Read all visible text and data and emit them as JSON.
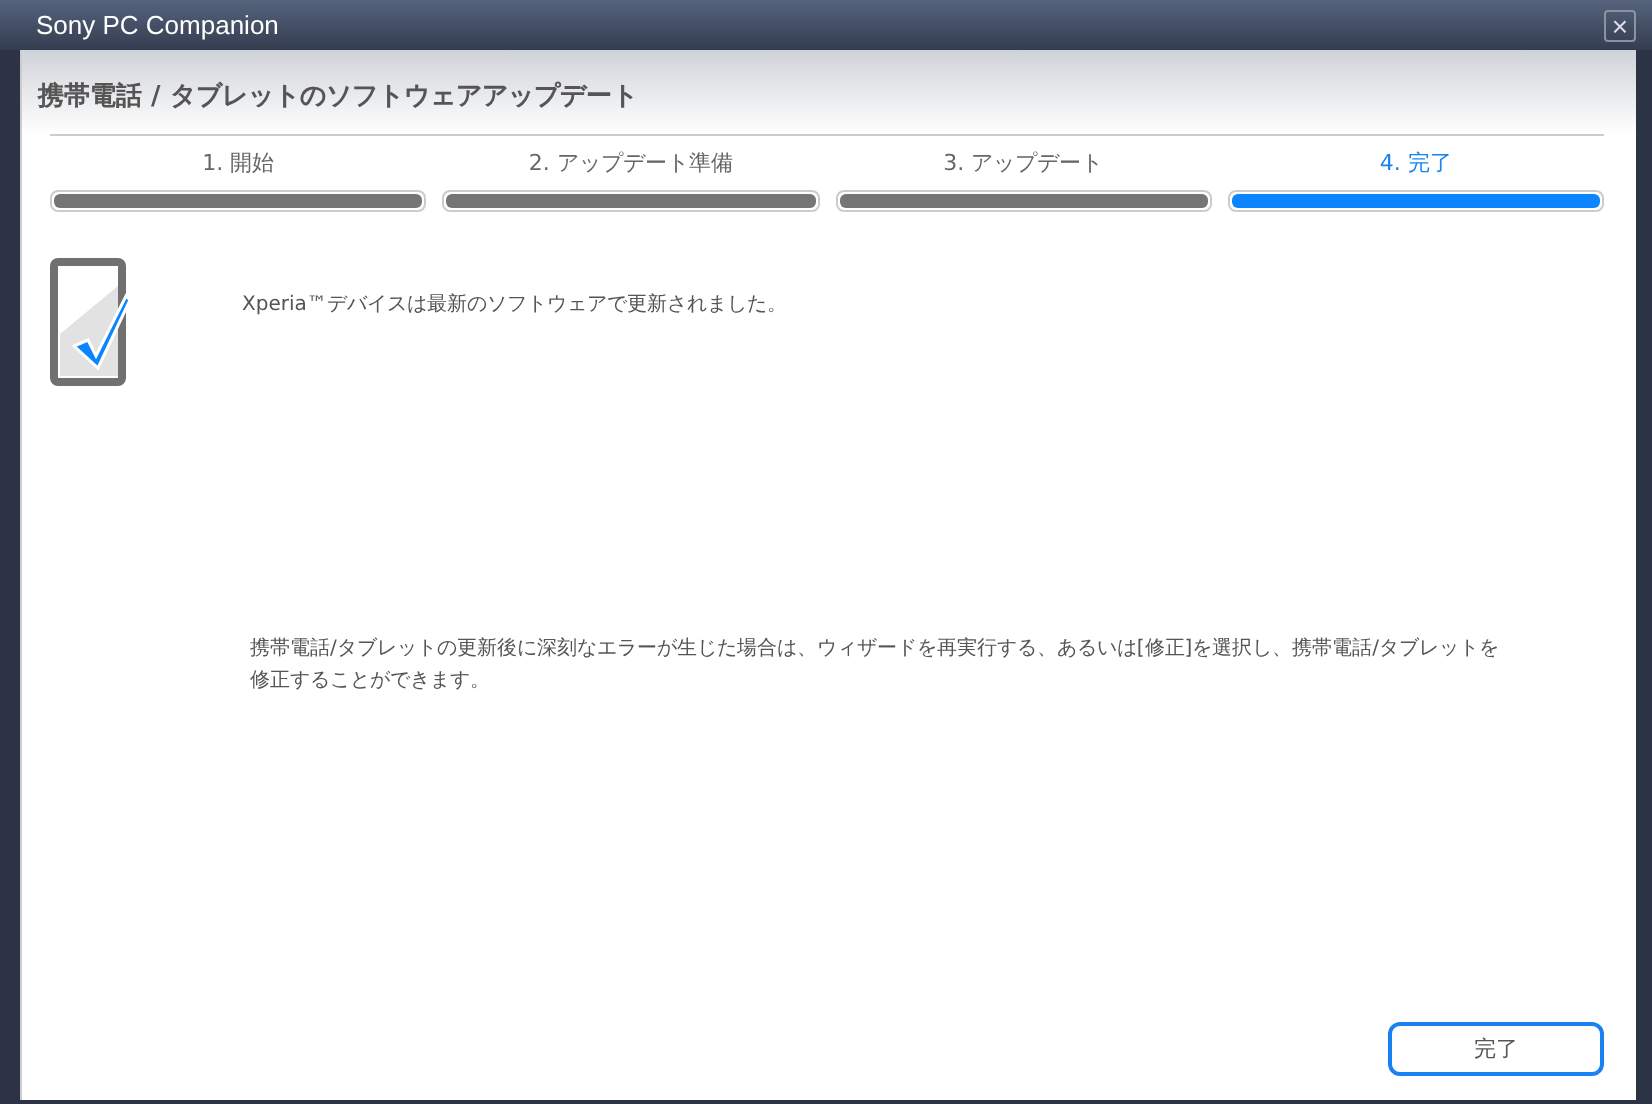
{
  "window": {
    "title": "Sony PC Companion",
    "close": "×"
  },
  "heading": "携帯電話 / タブレットのソフトウェアアップデート",
  "steps": [
    {
      "label": "1. 開始",
      "selected": false
    },
    {
      "label": "2. アップデート準備",
      "selected": false
    },
    {
      "label": "3. アップデート",
      "selected": false
    },
    {
      "label": "4. 完了",
      "selected": true
    }
  ],
  "message": "Xperia™デバイスは最新のソフトウェアで更新されました。",
  "note": "携帯電話/タブレットの更新後に深刻なエラーが生じた場合は、ウィザードを再実行する、あるいは[修正]を選択し、携帯電話/タブレットを修正することができます。",
  "buttons": [
    "完了"
  ]
}
